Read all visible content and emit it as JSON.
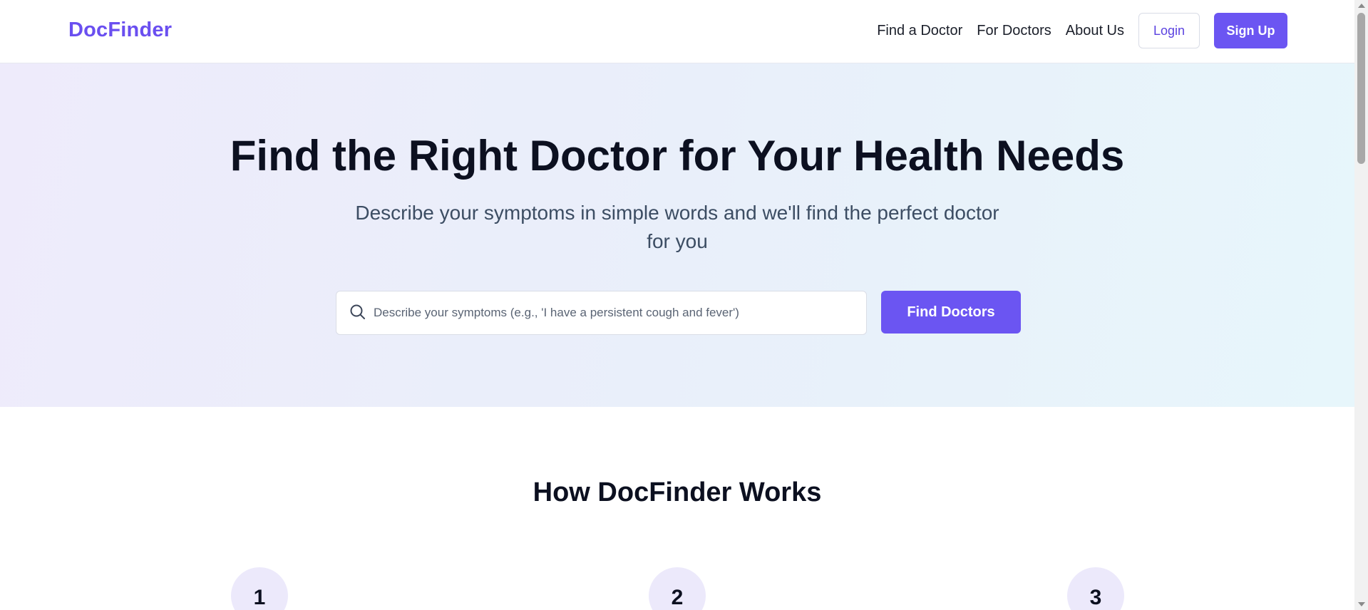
{
  "header": {
    "logo": "DocFinder",
    "nav": [
      {
        "label": "Find a Doctor"
      },
      {
        "label": "For Doctors"
      },
      {
        "label": "About Us"
      }
    ],
    "login_label": "Login",
    "signup_label": "Sign Up"
  },
  "hero": {
    "title": "Find the Right Doctor for Your Health Needs",
    "subtitle": "Describe your symptoms in simple words and we'll find the perfect doctor for you",
    "search": {
      "icon": "search-icon",
      "placeholder": "Describe your symptoms (e.g., 'I have a persistent cough and fever')",
      "value": ""
    },
    "find_button_label": "Find Doctors"
  },
  "how_it_works": {
    "title": "How DocFinder Works",
    "steps": [
      {
        "number": "1"
      },
      {
        "number": "2"
      },
      {
        "number": "3"
      }
    ]
  },
  "colors": {
    "accent": "#6b55f2",
    "logo": "#6a4ff0",
    "heading": "#0c1020",
    "subtitle": "#3c4d63",
    "hero_gradient_start": "#eeebfb",
    "hero_gradient_end": "#e7f6fb",
    "step_circle": "#ece9fb"
  }
}
